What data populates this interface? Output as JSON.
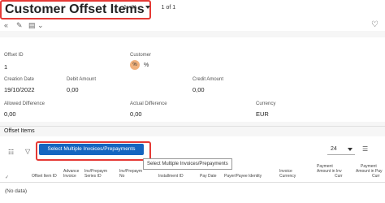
{
  "header": {
    "title": "Customer Offset Items",
    "pager_range": "1 - % -",
    "pager_count": "1 of 1"
  },
  "toolbar": {
    "icons": [
      "collapse-left-icon",
      "edit-icon",
      "clipboard-menu-icon",
      "favorite-heart-icon"
    ]
  },
  "fields": {
    "offset_id_label": "Offset ID",
    "offset_id_value": "1",
    "customer_label": "Customer",
    "customer_badge": "%",
    "customer_value": "%",
    "creation_date_label": "Creation Date",
    "creation_date_value": "19/10/2022",
    "debit_amount_label": "Debit Amount",
    "debit_amount_value": "0,00",
    "credit_amount_label": "Credit Amount",
    "credit_amount_value": "0,00",
    "allowed_difference_label": "Allowed Difference",
    "allowed_difference_value": "0,00",
    "actual_difference_label": "Actual Difference",
    "actual_difference_value": "0,00",
    "currency_label": "Currency",
    "currency_value": "EUR"
  },
  "items": {
    "section_title": "Offset Items",
    "select_button_label": "Select Multiple Invoices/Prepayments",
    "tooltip": "Select Multiple Invoices/Prepayments",
    "page_size": "24",
    "columns": {
      "c1": "Offset Item ID",
      "c2a": "Advance",
      "c2b": "Invoice",
      "c3a": "Inv/Prepaym",
      "c3b": "Series ID",
      "c4a": "Inv/Prepaym",
      "c4b": "No",
      "c5": "Installment ID",
      "c6": "Pay Date",
      "c7": "Payer/Payee Identity",
      "c8a": "Invoice",
      "c8b": "Currency",
      "c9a": "Payment",
      "c9b": "Amount in Inv",
      "c9c": "Curr",
      "c10a": "Payment",
      "c10b": "Amount in Pay",
      "c10c": "Curr"
    },
    "empty_text": "(No data)"
  }
}
